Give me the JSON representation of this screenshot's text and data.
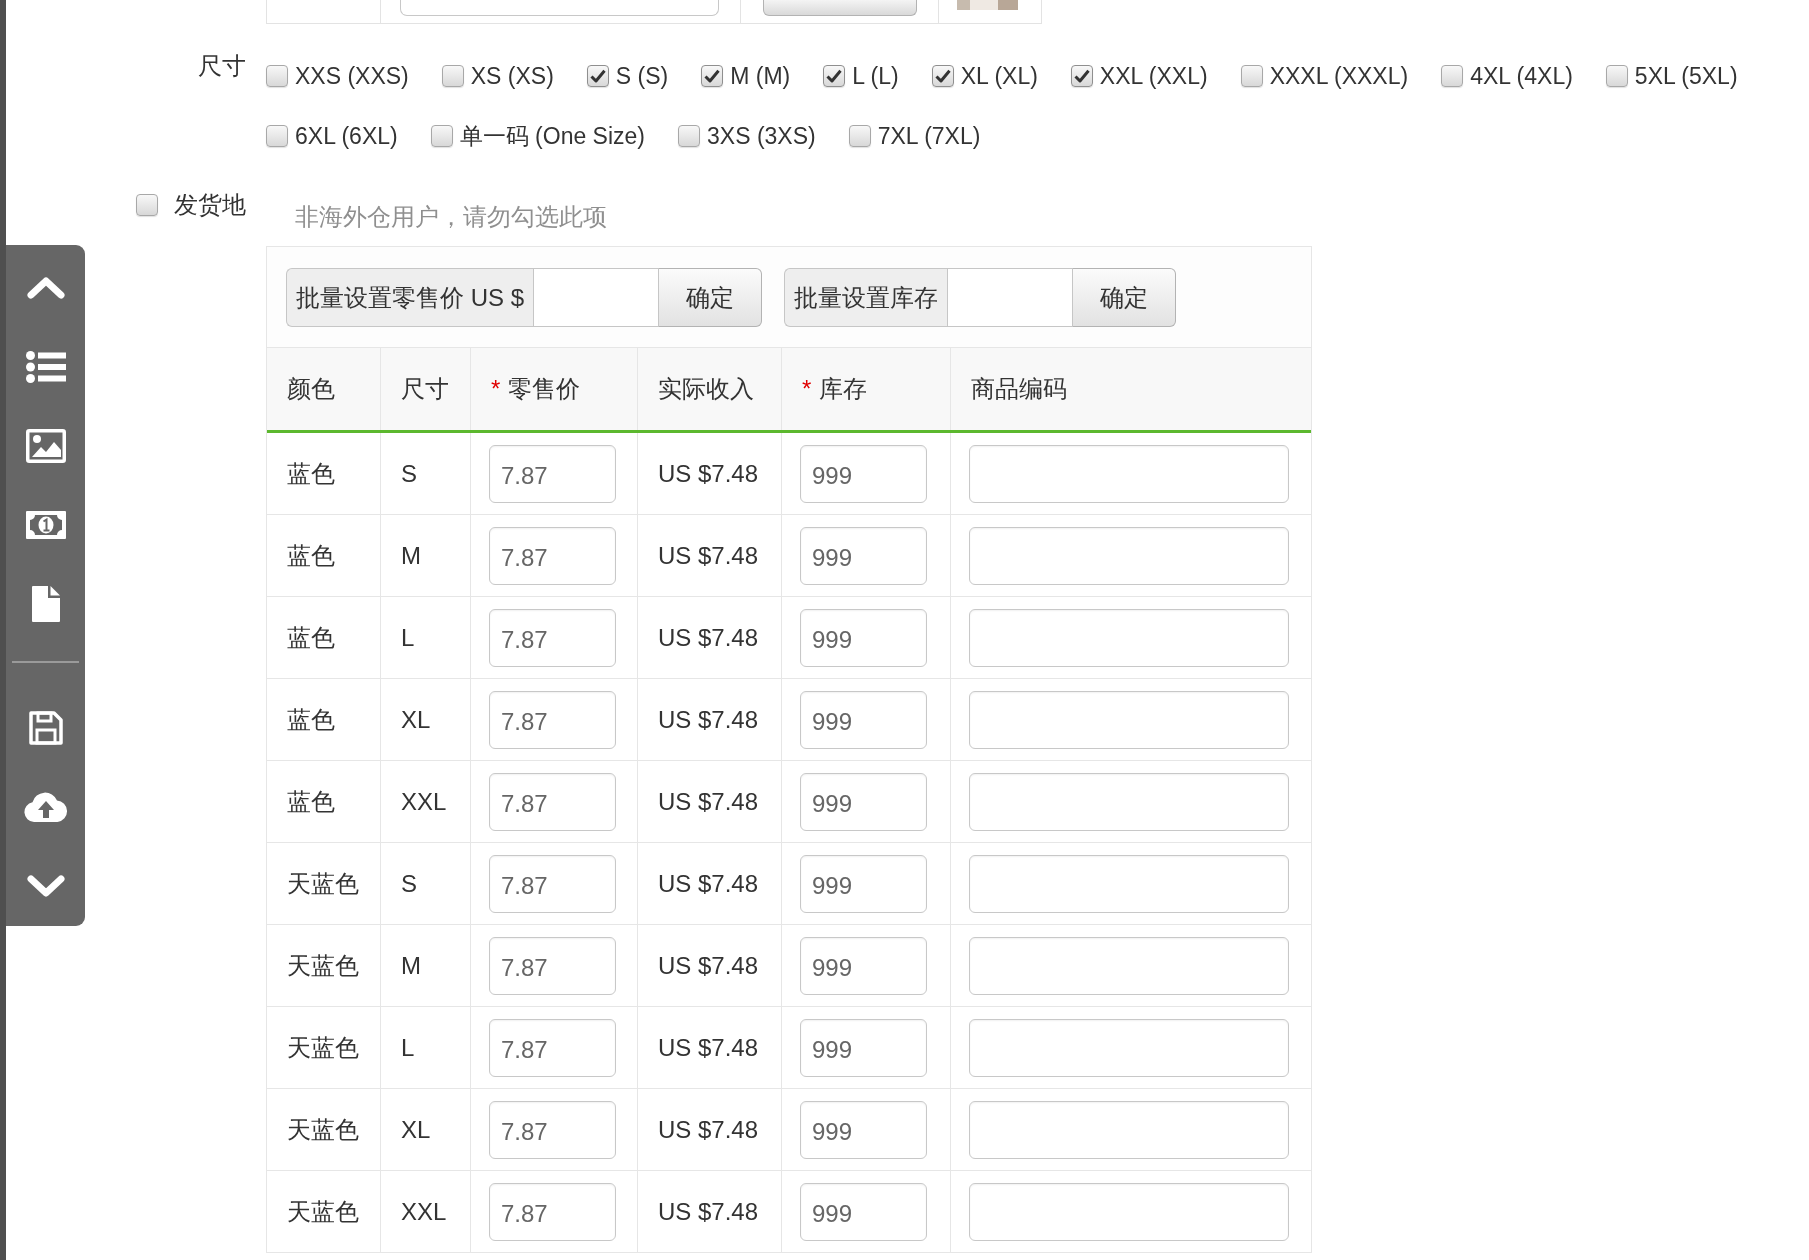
{
  "size_field": {
    "label": "尺寸",
    "options": [
      {
        "label": "XXS (XXS)",
        "checked": false
      },
      {
        "label": "XS (XS)",
        "checked": false
      },
      {
        "label": "S (S)",
        "checked": true
      },
      {
        "label": "M (M)",
        "checked": true
      },
      {
        "label": "L (L)",
        "checked": true
      },
      {
        "label": "XL (XL)",
        "checked": true
      },
      {
        "label": "XXL (XXL)",
        "checked": true
      },
      {
        "label": "XXXL (XXXL)",
        "checked": false
      },
      {
        "label": "4XL (4XL)",
        "checked": false
      },
      {
        "label": "5XL (5XL)",
        "checked": false
      },
      {
        "label": "6XL (6XL)",
        "checked": false
      },
      {
        "label": "单一码 (One Size)",
        "checked": false
      },
      {
        "label": "3XS (3XS)",
        "checked": false
      },
      {
        "label": "7XL (7XL)",
        "checked": false
      }
    ]
  },
  "shipping_field": {
    "label": "发货地",
    "checked": false,
    "hint": "非海外仓用户，请勿勾选此项"
  },
  "sku_table": {
    "batch_actions": [
      {
        "label": "批量设置零售价 US $",
        "button": "确定"
      },
      {
        "label": "批量设置库存",
        "button": "确定"
      }
    ],
    "columns": [
      {
        "label": "颜色"
      },
      {
        "label": "尺寸"
      },
      {
        "label": "零售价",
        "required_mark": "*"
      },
      {
        "label": "实际收入"
      },
      {
        "label": "库存",
        "required_mark": "*"
      },
      {
        "label": "商品编码"
      }
    ],
    "rows": [
      {
        "color_name": "蓝色",
        "size": "S",
        "price": "7.87",
        "income": "US $7.48",
        "stock": "999"
      },
      {
        "color_name": "蓝色",
        "size": "M",
        "price": "7.87",
        "income": "US $7.48",
        "stock": "999"
      },
      {
        "color_name": "蓝色",
        "size": "L",
        "price": "7.87",
        "income": "US $7.48",
        "stock": "999"
      },
      {
        "color_name": "蓝色",
        "size": "XL",
        "price": "7.87",
        "income": "US $7.48",
        "stock": "999"
      },
      {
        "color_name": "蓝色",
        "size": "XXL",
        "price": "7.87",
        "income": "US $7.48",
        "stock": "999"
      },
      {
        "color_name": "天蓝色",
        "size": "S",
        "price": "7.87",
        "income": "US $7.48",
        "stock": "999"
      },
      {
        "color_name": "天蓝色",
        "size": "M",
        "price": "7.87",
        "income": "US $7.48",
        "stock": "999"
      },
      {
        "color_name": "天蓝色",
        "size": "L",
        "price": "7.87",
        "income": "US $7.48",
        "stock": "999"
      },
      {
        "color_name": "天蓝色",
        "size": "XL",
        "price": "7.87",
        "income": "US $7.48",
        "stock": "999"
      },
      {
        "color_name": "天蓝色",
        "size": "XXL",
        "price": "7.87",
        "income": "US $7.48",
        "stock": "999"
      }
    ]
  }
}
